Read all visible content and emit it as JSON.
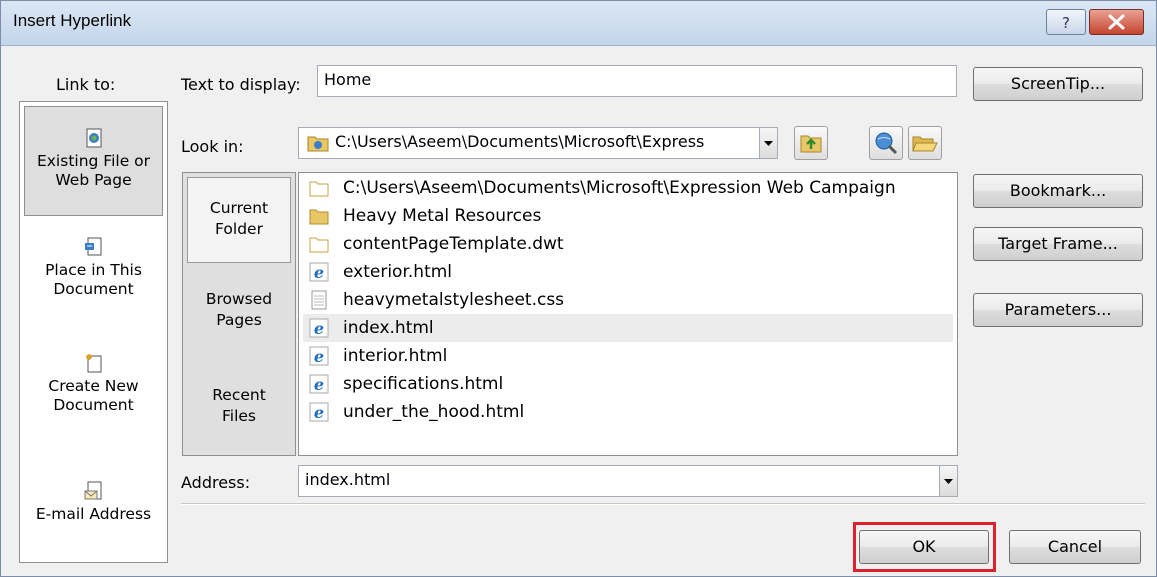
{
  "window": {
    "title": "Insert Hyperlink",
    "help_glyph": "?",
    "close_glyph": "✕"
  },
  "link_to": {
    "label": "Link to:",
    "items": [
      {
        "line1": "Existing File or",
        "line2": "Web Page",
        "icon": "existing-file-icon"
      },
      {
        "line1": "Place in This",
        "line2": "Document",
        "icon": "place-in-document-icon"
      },
      {
        "line1": "Create New",
        "line2": "Document",
        "icon": "create-new-document-icon"
      },
      {
        "line1": "E-mail Address",
        "line2": "",
        "icon": "email-address-icon"
      }
    ]
  },
  "text_to_display": {
    "label": "Text to display:",
    "value": "Home"
  },
  "look_in": {
    "label": "Look in:",
    "value": "C:\\Users\\Aseem\\Documents\\Microsoft\\Express"
  },
  "nav": {
    "items": [
      {
        "line1": "Current",
        "line2": "Folder"
      },
      {
        "line1": "Browsed",
        "line2": "Pages"
      },
      {
        "line1": "Recent",
        "line2": "Files"
      }
    ]
  },
  "files": [
    {
      "name": "C:\\Users\\Aseem\\Documents\\Microsoft\\Expression Web Campaign",
      "icon": "folder-open-icon"
    },
    {
      "name": "Heavy Metal Resources",
      "icon": "folder-icon"
    },
    {
      "name": "contentPageTemplate.dwt",
      "icon": "folder-open-icon"
    },
    {
      "name": "exterior.html",
      "icon": "ie-html-icon"
    },
    {
      "name": "heavymetalstylesheet.css",
      "icon": "text-file-icon"
    },
    {
      "name": "index.html",
      "icon": "ie-html-icon"
    },
    {
      "name": "interior.html",
      "icon": "ie-html-icon"
    },
    {
      "name": "specifications.html",
      "icon": "ie-html-icon"
    },
    {
      "name": "under_the_hood.html",
      "icon": "ie-html-icon"
    }
  ],
  "selected_file": "index.html",
  "address": {
    "label": "Address:",
    "value": "index.html"
  },
  "buttons": {
    "screentip": "ScreenTip...",
    "bookmark": "Bookmark...",
    "target_frame": "Target Frame...",
    "parameters": "Parameters...",
    "ok": "OK",
    "cancel": "Cancel"
  },
  "colors": {
    "highlight_border": "#e0202a",
    "titlebar": "#c4d5ea",
    "close_button": "#c5432f"
  }
}
